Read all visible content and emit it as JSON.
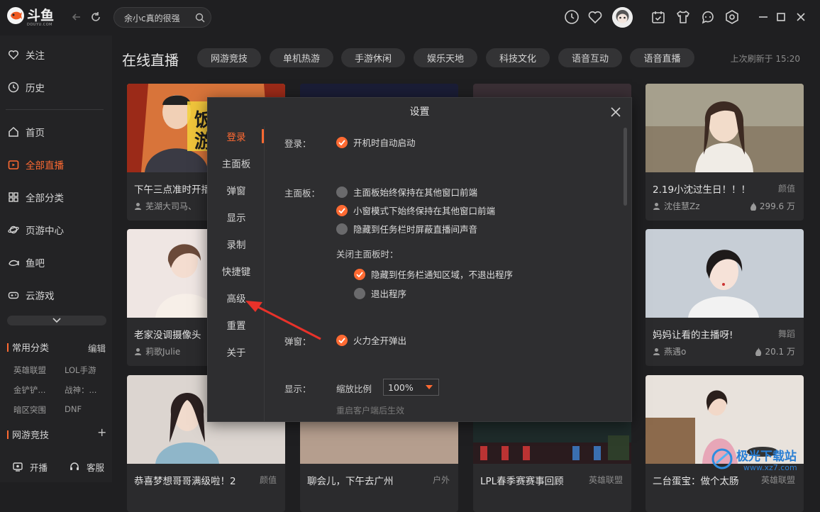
{
  "app": {
    "logo_text": "斗鱼",
    "logo_sub": "DOUYU.COM",
    "search_value": "余小c真的很强"
  },
  "sidebar": {
    "top_items": [
      {
        "label": "关注",
        "icon": "heart-icon"
      },
      {
        "label": "历史",
        "icon": "clock-icon"
      }
    ],
    "nav_items": [
      {
        "label": "首页",
        "icon": "home-icon",
        "active": false
      },
      {
        "label": "全部直播",
        "icon": "live-tv-icon",
        "active": true
      },
      {
        "label": "全部分类",
        "icon": "grid-icon",
        "active": false
      },
      {
        "label": "页游中心",
        "icon": "planet-icon",
        "active": false
      },
      {
        "label": "鱼吧",
        "icon": "fish-icon",
        "active": false
      },
      {
        "label": "云游戏",
        "icon": "gamepad-icon",
        "active": false
      }
    ],
    "common_section": {
      "title": "常用分类",
      "action": "编辑"
    },
    "categories": [
      "英雄联盟",
      "LOL手游",
      "金铲铲...",
      "战神：...",
      "暗区突围",
      "DNF"
    ],
    "esports_section": {
      "title": "网游竞技",
      "action": "+"
    },
    "bottom": [
      {
        "label": "开播",
        "icon": "broadcast-icon"
      },
      {
        "label": "客服",
        "icon": "headset-icon"
      }
    ]
  },
  "main": {
    "title": "在线直播",
    "tabs": [
      "网游竞技",
      "单机热游",
      "手游休闲",
      "娱乐天地",
      "科技文化",
      "语音互动",
      "语音直播"
    ],
    "refresh_text": "上次刷新于 15:20",
    "cards": [
      {
        "title": "下午三点准时开播",
        "tag": "",
        "user": "芜湖大司马、",
        "heat": ""
      },
      {
        "title": "",
        "tag": "",
        "user": "",
        "heat": ""
      },
      {
        "title": "",
        "tag": "",
        "user": "",
        "heat": ""
      },
      {
        "title": "2.19小沈过生日！！！",
        "tag": "颜值",
        "user": "沈佳慧Zz",
        "heat": "299.6 万"
      },
      {
        "title": "老家没调摄像头",
        "tag": "",
        "user": "莉歌Julie",
        "heat": ""
      },
      {
        "title": "",
        "tag": "",
        "user": "",
        "heat": ""
      },
      {
        "title": "",
        "tag": "",
        "user": "",
        "heat": ""
      },
      {
        "title": "妈妈让看的主播呀!",
        "tag": "舞蹈",
        "user": "燕遇o",
        "heat": "20.1 万"
      },
      {
        "title": "恭喜梦想哥哥满级啦！2",
        "tag": "颜值",
        "user": "",
        "heat": ""
      },
      {
        "title": "聊会儿，下午去广州",
        "tag": "户外",
        "user": "",
        "heat": ""
      },
      {
        "title": "LPL春季赛赛事回顾",
        "tag": "英雄联盟",
        "user": "",
        "heat": ""
      },
      {
        "title": "二台蛋宝：做个太肠",
        "tag": "英雄联盟",
        "user": "",
        "heat": ""
      }
    ]
  },
  "dialog": {
    "title": "设置",
    "nav": [
      "登录",
      "主面板",
      "弹窗",
      "显示",
      "录制",
      "快捷键",
      "高级",
      "重置",
      "关于"
    ],
    "active_nav": "登录",
    "login": {
      "label": "登录：",
      "option": "开机时自动启动",
      "checked": true
    },
    "panel": {
      "label": "主面板：",
      "options": [
        {
          "text": "主面板始终保持在其他窗口前端",
          "checked": false
        },
        {
          "text": "小窗模式下始终保持在其他窗口前端",
          "checked": true
        },
        {
          "text": "隐藏到任务栏时屏蔽直播间声音",
          "checked": false
        }
      ],
      "close_label": "关闭主面板时：",
      "close_options": [
        {
          "text": "隐藏到任务栏通知区域，不退出程序",
          "checked": true
        },
        {
          "text": "退出程序",
          "checked": false
        }
      ]
    },
    "popup": {
      "label": "弹窗：",
      "option": "火力全开弹出",
      "checked": true
    },
    "display": {
      "label": "显示：",
      "zoom_label": "缩放比例",
      "zoom_value": "100%",
      "hint": "重启客户端后生效"
    }
  },
  "watermark": {
    "text": "极光下载站",
    "url": "www.xz7.com"
  },
  "colors": {
    "accent": "#ff6a32",
    "bg": "#1f1f21",
    "dialog_bg": "#2e2e30"
  }
}
